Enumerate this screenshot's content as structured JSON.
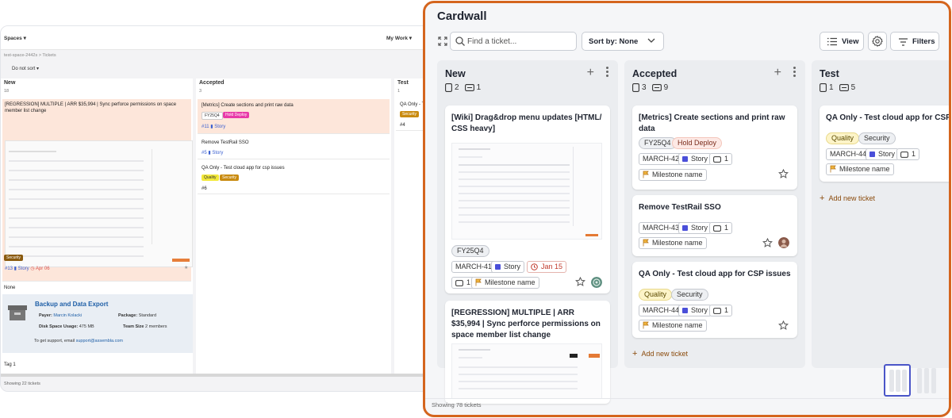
{
  "old_ui": {
    "spaces_label": "Spaces",
    "mywork_label": "My Work",
    "breadcrumb": "test-space-2442s > Tickets",
    "sort_label": "Do not sort",
    "columns": [
      {
        "name": "New",
        "count": "18"
      },
      {
        "name": "Accepted",
        "count": "3"
      },
      {
        "name": "Test",
        "count": "1"
      }
    ],
    "cards": {
      "regression": "[REGRESSION] MULTIPLE | ARR $35,994 | Sync perforce permissions on space member list change",
      "metrics": "[Metrics] Create sections and print raw data",
      "metrics_tags": [
        "FY25Q4",
        "Hold Deploy"
      ],
      "metrics_id": "#11",
      "remove": "Remove TestRail SSO",
      "remove_id": "#5",
      "qa": "QA Only - Test cloud app for csp issues",
      "qa_tags": [
        "Quality",
        "Security"
      ],
      "qa_id": "#6",
      "test_card": "QA Only - Test cl...",
      "test_tag": "Security",
      "test_id": "#4",
      "story_label": "Story",
      "regression_meta": "#13",
      "regression_due": "Apr 06",
      "security_tag": "Security"
    },
    "none_label": "None",
    "backup": {
      "title": "Backup and Data Export",
      "payer": "Payer:",
      "payer_name": "Marcin Kolacki",
      "package": "Package:",
      "package_value": "Standard",
      "disk": "Disk Space Usage:",
      "disk_value": "475 MB",
      "team": "Team Size",
      "team_value": "2 members",
      "support": "To get support, email",
      "support_email": "support@assembla.com"
    },
    "tag_label": "Tag 1",
    "showing": "Showing 22 tickets"
  },
  "panel": {
    "title": "Cardwall",
    "search_placeholder": "Find a ticket...",
    "sort_prefix": "Sort by:",
    "sort_value": "None",
    "view_label": "View",
    "filters_label": "Filters",
    "footer": "Showing 78 tickets",
    "columns": [
      {
        "name": "New",
        "tickets": "2",
        "stories": "1",
        "cards": [
          {
            "title": "[Wiki] Drag&drop menu updates [HTML/ CSS heavy]",
            "chips": [
              "FY25Q4"
            ],
            "id": "MARCH-41",
            "type": "Story",
            "due": "Jan 15",
            "comments": "1",
            "milestone": "Milestone name"
          },
          {
            "title": "[REGRESSION] MULTIPLE | ARR $35,994 | Sync perforce permissions on space member list change"
          }
        ]
      },
      {
        "name": "Accepted",
        "tickets": "3",
        "stories": "9",
        "add_label": "Add new ticket",
        "cards": [
          {
            "title": "[Metrics] Create sections and print raw data",
            "chips": [
              "FY25Q4",
              "Hold Deploy"
            ],
            "id": "MARCH-42",
            "type": "Story",
            "comments": "1",
            "milestone": "Milestone name"
          },
          {
            "title": "Remove TestRail SSO",
            "id": "MARCH-43",
            "type": "Story",
            "comments": "1",
            "milestone": "Milestone name"
          },
          {
            "title": "QA Only - Test cloud app for CSP issues",
            "chips": [
              "Quality",
              "Security"
            ],
            "id": "MARCH-44",
            "type": "Story",
            "comments": "1",
            "milestone": "Milestone name"
          }
        ]
      },
      {
        "name": "Test",
        "tickets": "1",
        "stories": "5",
        "add_label": "Add new ticket",
        "cards": [
          {
            "title": "QA Only - Test cloud app for CSP issues",
            "chips": [
              "Quality",
              "Security"
            ],
            "id": "MARCH-44",
            "type": "Story",
            "comments": "1",
            "milestone": "Milestone name"
          }
        ]
      }
    ]
  },
  "colors": {
    "accent_border": "#d4651e",
    "story_square": "#4a4fd9",
    "due_red": "#c0392b",
    "add_ticket": "#8a4a0b"
  }
}
